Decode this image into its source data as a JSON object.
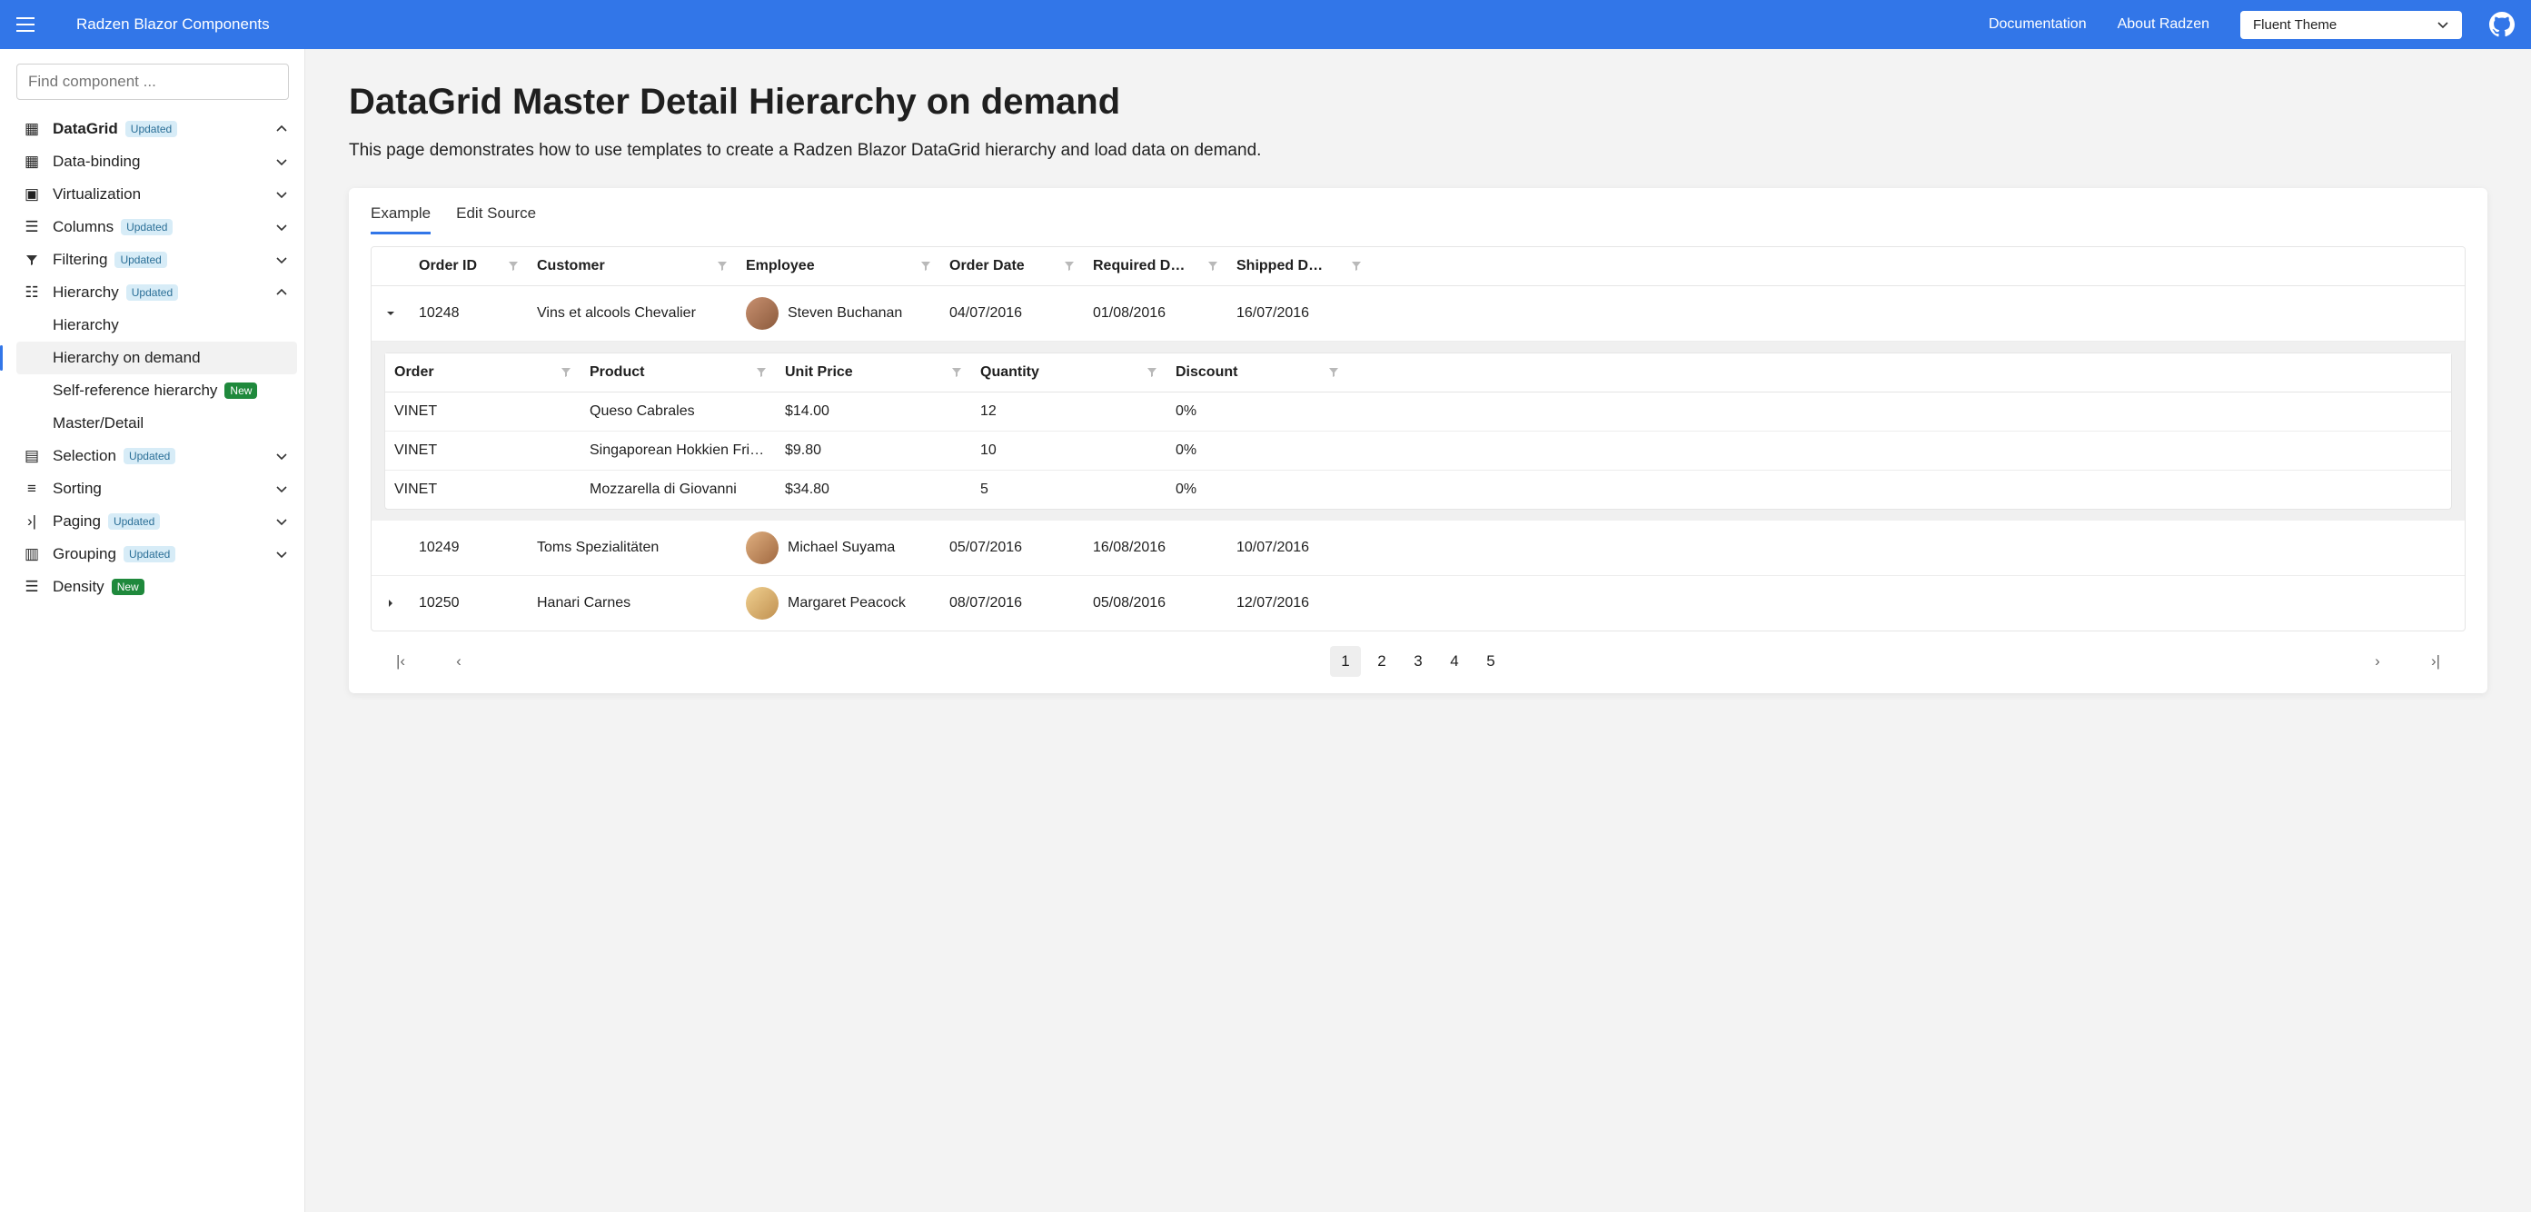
{
  "header": {
    "brand": "Radzen Blazor Components",
    "doc": "Documentation",
    "about": "About Radzen",
    "theme": "Fluent Theme"
  },
  "sidebar": {
    "find_placeholder": "Find component ...",
    "root": {
      "label": "DataGrid",
      "badge": "Updated"
    },
    "groups": [
      {
        "label": "Data-binding"
      },
      {
        "label": "Virtualization"
      },
      {
        "label": "Columns",
        "badge": "Updated"
      },
      {
        "label": "Filtering",
        "badge": "Updated"
      },
      {
        "label": "Hierarchy",
        "badge": "Updated",
        "expanded": true
      },
      {
        "label": "Selection",
        "badge": "Updated"
      },
      {
        "label": "Sorting"
      },
      {
        "label": "Paging",
        "badge": "Updated"
      },
      {
        "label": "Grouping",
        "badge": "Updated"
      },
      {
        "label": "Density",
        "badge": "New",
        "new": true
      }
    ],
    "children": [
      {
        "label": "Hierarchy"
      },
      {
        "label": "Hierarchy on demand",
        "selected": true
      },
      {
        "label": "Self-reference hierarchy",
        "badge": "New",
        "new": true
      },
      {
        "label": "Master/Detail"
      }
    ]
  },
  "page": {
    "title": "DataGrid Master Detail Hierarchy on demand",
    "lead": "This page demonstrates how to use templates to create a Radzen Blazor DataGrid hierarchy and load data on demand."
  },
  "tabs": {
    "example": "Example",
    "edit": "Edit Source"
  },
  "columns": {
    "order_id": "Order ID",
    "customer": "Customer",
    "employee": "Employee",
    "order_date": "Order Date",
    "required": "Required D…",
    "shipped": "Shipped D…"
  },
  "rows": [
    {
      "id": "10248",
      "customer": "Vins et alcools Chevalier",
      "employee": "Steven Buchanan",
      "od": "04/07/2016",
      "rd": "01/08/2016",
      "sd": "16/07/2016",
      "expanded": true
    },
    {
      "id": "10249",
      "customer": "Toms Spezialitäten",
      "employee": "Michael Suyama",
      "od": "05/07/2016",
      "rd": "16/08/2016",
      "sd": "10/07/2016"
    },
    {
      "id": "10250",
      "customer": "Hanari Carnes",
      "employee": "Margaret Peacock",
      "od": "08/07/2016",
      "rd": "05/08/2016",
      "sd": "12/07/2016",
      "collapsed": true
    }
  ],
  "sub_columns": {
    "order": "Order",
    "product": "Product",
    "price": "Unit Price",
    "qty": "Quantity",
    "disc": "Discount"
  },
  "sub_rows": [
    {
      "order": "VINET",
      "product": "Queso Cabrales",
      "price": "$14.00",
      "qty": "12",
      "disc": "0%"
    },
    {
      "order": "VINET",
      "product": "Singaporean Hokkien Fri…",
      "price": "$9.80",
      "qty": "10",
      "disc": "0%"
    },
    {
      "order": "VINET",
      "product": "Mozzarella di Giovanni",
      "price": "$34.80",
      "qty": "5",
      "disc": "0%"
    }
  ],
  "pager": {
    "pages": [
      "1",
      "2",
      "3",
      "4",
      "5"
    ],
    "active": "1"
  }
}
